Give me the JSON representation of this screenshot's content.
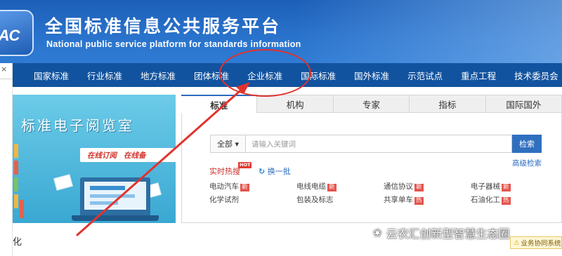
{
  "header": {
    "logo_text": "SAC",
    "title_cn": "全国标准信息公共服务平台",
    "title_en": "National public service platform  for standards information"
  },
  "nav": {
    "items": [
      "国家标准",
      "行业标准",
      "地方标准",
      "团体标准",
      "企业标准",
      "国际标准",
      "国外标准",
      "示范试点",
      "重点工程",
      "技术委员会"
    ]
  },
  "left": {
    "close_symbol": "×",
    "bottom_text": "化"
  },
  "banner": {
    "title": "标准电子阅览室",
    "tags": [
      "在线订阅",
      "在线备"
    ]
  },
  "tabs": [
    "标准",
    "机构",
    "专家",
    "指标",
    "国际国外"
  ],
  "search": {
    "scope": "全部 ▾",
    "placeholder": "请输入关键词",
    "button": "检索",
    "advanced": "高级检索"
  },
  "hot": {
    "label": "实时热搜",
    "badge": "HOT",
    "refresh_icon": "↻",
    "refresh_label": "换一批",
    "keywords": [
      {
        "text": "电动汽车",
        "tag": "新"
      },
      {
        "text": "电线电缆",
        "tag": "新"
      },
      {
        "text": "通信协议",
        "tag": "新"
      },
      {
        "text": "电子器械",
        "tag": "新"
      },
      {
        "text": "化学试剂",
        "tag": ""
      },
      {
        "text": "包装及标志",
        "tag": ""
      },
      {
        "text": "共享单车",
        "tag": "热"
      },
      {
        "text": "石油化工",
        "tag": "热"
      }
    ]
  },
  "watermark": {
    "icon": "wechat-icon",
    "text": "云农汇创新型智慧生态圈"
  },
  "corner_badge": {
    "text": "业务协同系统"
  },
  "colors": {
    "header_blue": "#2a73cc",
    "nav_blue": "#12539f",
    "annotation_red": "#e2322d",
    "link_blue": "#2a6cc0"
  }
}
